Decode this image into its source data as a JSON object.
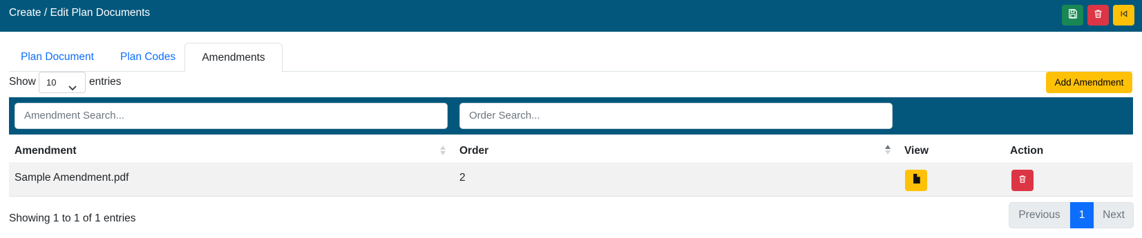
{
  "header": {
    "title": "Create / Edit Plan Documents",
    "buttons": [
      {
        "name": "save",
        "icon": "save-icon",
        "color": "#198754"
      },
      {
        "name": "delete",
        "icon": "trash-icon",
        "color": "#dc3545"
      },
      {
        "name": "back",
        "icon": "back-icon",
        "color": "#ffc107"
      }
    ],
    "bar_color": "#03577c"
  },
  "tabs": [
    {
      "label": "Plan Document",
      "active": false
    },
    {
      "label": "Plan Codes",
      "active": false
    },
    {
      "label": "Amendments",
      "active": true
    }
  ],
  "length_menu": {
    "show_label": "Show",
    "selected": "10",
    "entries_label": "entries"
  },
  "add_button": {
    "label": "Add Amendment"
  },
  "filters": {
    "amendment_placeholder": "Amendment Search...",
    "order_placeholder": "Order Search..."
  },
  "table": {
    "columns": [
      "Amendment",
      "Order",
      "View",
      "Action"
    ],
    "rows": [
      {
        "amendment": "Sample Amendment.pdf",
        "order": "2"
      }
    ]
  },
  "footer": {
    "info": "Showing 1 to 1 of 1 entries",
    "pagination": {
      "previous": "Previous",
      "current": "1",
      "next": "Next"
    }
  }
}
